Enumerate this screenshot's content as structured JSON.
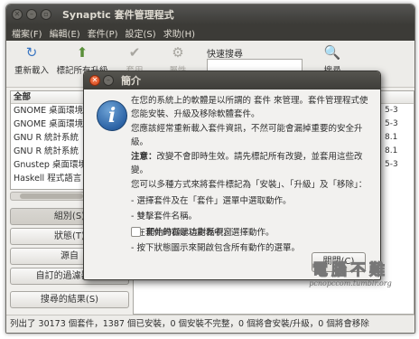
{
  "window": {
    "title": "Synaptic 套件管理程式"
  },
  "menu": [
    "檔案(F)",
    "編輯(E)",
    "套件(P)",
    "設定(S)",
    "求助(H)"
  ],
  "toolbar": {
    "reload": "重新載入",
    "mark_all": "標記所有升級",
    "apply": "套用",
    "properties": "屬性",
    "search_label": "快速搜尋",
    "search_value": "",
    "search_button": "搜尋"
  },
  "package_list": {
    "header": "全部",
    "rows": [
      "GNOME 桌面環境",
      "GNOME 桌面環境",
      "GNU R 統計系統",
      "GNU R 統計系統",
      "Gnustep 桌面環境",
      "Haskell 程式語言"
    ]
  },
  "version_fragments": [
    "5-3",
    "5-3",
    "8.1",
    "8.1",
    "5-3"
  ],
  "filters": {
    "sections": "組別(S)",
    "status": "狀態(T)",
    "origin": "源自",
    "custom": "自訂的過濾器(C)",
    "search_results": "搜尋的結果(S)"
  },
  "statusbar": "列出了 30173 個套件，1387 個已安裝，0 個安裝不完整，0 個將會安裝/升級，0 個將會移除",
  "dialog": {
    "title": "簡介",
    "p1": "在您的系統上的軟體是以所謂的 套件 來管理。套件管理程式使您能安裝、升級及移除軟體套件。",
    "p2": "您應該經常重新載入套件資訊，不然可能會漏掉重要的安全升級。",
    "note_label": "注意：",
    "note_text": "改變不會即時生效。請先標記所有改變，並套用這些改變。",
    "p4": "您可以多種方式來將套件標記為「安裝」、「升級」及「移除」：",
    "items": [
      "- 選擇套件及在「套件」選單中選取動作。",
      "- 雙擊套件名稱。",
      "- 在套件的右鍵功能表中，選擇動作。",
      "- 按下狀態圖示來開啟包含所有動作的選單。"
    ],
    "checkbox_label": "開始時顯示這對話視窗",
    "close_button": "關閉(C)"
  },
  "watermark": {
    "main": "電腦不難",
    "sub": "pcnopccom.tumblr.org"
  }
}
